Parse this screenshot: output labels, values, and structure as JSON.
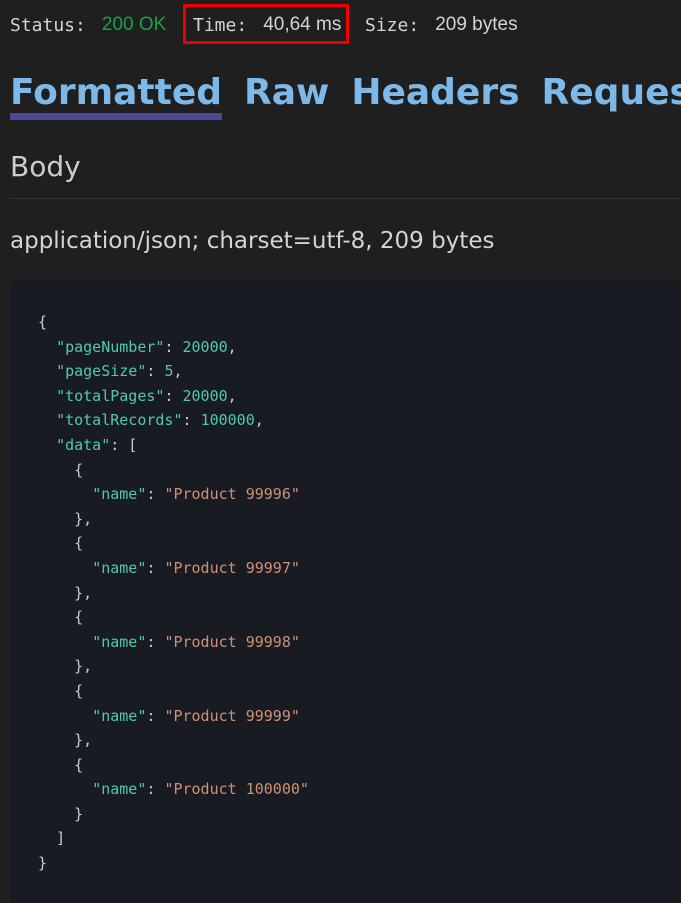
{
  "status_bar": {
    "status_label": "Status:",
    "status_value": "200 OK",
    "time_label": "Time:",
    "time_value": "40,64 ms",
    "size_label": "Size:",
    "size_value": "209 bytes",
    "colors": {
      "status_ok": "#16a34a",
      "highlight_box": "#ee0000"
    }
  },
  "tabs": [
    {
      "label": "Formatted",
      "active": true
    },
    {
      "label": "Raw",
      "active": false
    },
    {
      "label": "Headers",
      "active": false
    },
    {
      "label": "Request",
      "active": false
    }
  ],
  "body_heading": "Body",
  "content_type": "application/json; charset=utf-8, 209 bytes",
  "response": {
    "pageNumber": 20000,
    "pageSize": 5,
    "totalPages": 20000,
    "totalRecords": 100000,
    "data": [
      {
        "name": "Product 99996"
      },
      {
        "name": "Product 99997"
      },
      {
        "name": "Product 99998"
      },
      {
        "name": "Product 99999"
      },
      {
        "name": "Product 100000"
      }
    ]
  }
}
